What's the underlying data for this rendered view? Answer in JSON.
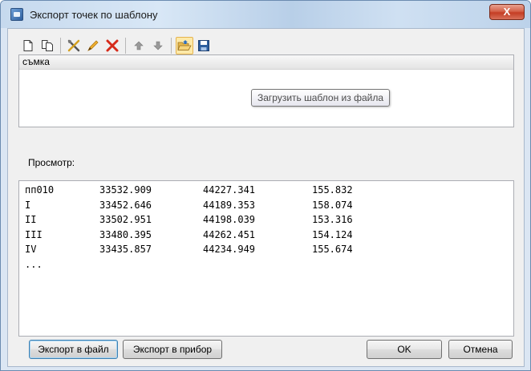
{
  "window": {
    "title": "Экспорт точек по шаблону",
    "close_label": "X",
    "title_icon": "export-app-icon"
  },
  "toolbar": {
    "buttons": [
      {
        "name": "new-icon",
        "tooltip": ""
      },
      {
        "name": "copy-icon",
        "tooltip": ""
      },
      {
        "name": "tools-icon",
        "tooltip": ""
      },
      {
        "name": "edit-pencil-icon",
        "tooltip": ""
      },
      {
        "name": "delete-icon",
        "tooltip": ""
      },
      {
        "name": "move-up-icon",
        "tooltip": ""
      },
      {
        "name": "move-down-icon",
        "tooltip": ""
      },
      {
        "name": "open-folder-icon",
        "tooltip": "Загрузить шаблон из файла"
      },
      {
        "name": "save-icon",
        "tooltip": ""
      }
    ]
  },
  "templates": {
    "items": [
      "съмка"
    ]
  },
  "tooltip": {
    "text": "Загрузить шаблон из файла"
  },
  "preview": {
    "label": "Просмотр:",
    "rows": [
      [
        "пп010",
        "33532.909",
        "44227.341",
        "155.832"
      ],
      [
        "I",
        "33452.646",
        "44189.353",
        "158.074"
      ],
      [
        "II",
        "33502.951",
        "44198.039",
        "153.316"
      ],
      [
        "III",
        "33480.395",
        "44262.451",
        "154.124"
      ],
      [
        "IV",
        "33435.857",
        "44234.949",
        "155.674"
      ],
      [
        "...",
        "",
        "",
        ""
      ]
    ]
  },
  "buttons": {
    "export_file": "Экспорт в файл",
    "export_device": "Экспорт в прибор",
    "ok": "OK",
    "cancel": "Отмена"
  },
  "colors": {
    "accent_red": "#d62a1a",
    "accent_blue": "#2d5e9e",
    "highlight": "#fde9a8"
  }
}
